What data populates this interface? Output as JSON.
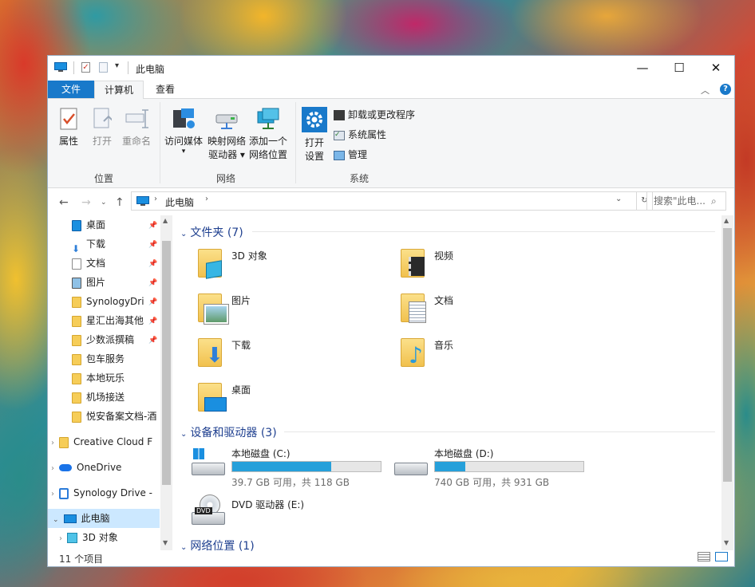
{
  "window": {
    "title": "此电脑"
  },
  "tabs": {
    "file": "文件",
    "computer": "计算机",
    "view": "查看"
  },
  "ribbon": {
    "location": {
      "label": "位置",
      "properties": "属性",
      "open": "打开",
      "rename": "重命名"
    },
    "network": {
      "label": "网络",
      "access_media": "访问媒体",
      "map_drive_1": "映射网络",
      "map_drive_2": "驱动器",
      "add_location_1": "添加一个",
      "add_location_2": "网络位置"
    },
    "system": {
      "label": "系统",
      "open_settings_1": "打开",
      "open_settings_2": "设置",
      "uninstall": "卸载或更改程序",
      "sys_props": "系统属性",
      "manage": "管理"
    }
  },
  "address": {
    "path": "此电脑",
    "search_placeholder": "搜索\"此电..."
  },
  "nav": {
    "quick": [
      {
        "label": "桌面",
        "pinned": true
      },
      {
        "label": "下载",
        "pinned": true
      },
      {
        "label": "文档",
        "pinned": true
      },
      {
        "label": "图片",
        "pinned": true
      },
      {
        "label": "SynologyDri",
        "pinned": true
      },
      {
        "label": "星汇出海其他",
        "pinned": true
      },
      {
        "label": "少数派撰稿",
        "pinned": true
      },
      {
        "label": "包车服务",
        "pinned": false
      },
      {
        "label": "本地玩乐",
        "pinned": false
      },
      {
        "label": "机场接送",
        "pinned": false
      },
      {
        "label": "悦安备案文档-酒",
        "pinned": false
      }
    ],
    "creative_cloud": "Creative Cloud F",
    "onedrive": "OneDrive",
    "synology_drive": "Synology Drive -",
    "this_pc": "此电脑",
    "objects_3d": "3D 对象"
  },
  "content": {
    "folders_header": "文件夹 (7)",
    "folders": [
      "3D 对象",
      "视频",
      "图片",
      "文档",
      "下载",
      "音乐",
      "桌面"
    ],
    "devices_header": "设备和驱动器 (3)",
    "drives": [
      {
        "name": "本地磁盘 (C:)",
        "info": "39.7 GB 可用，共 118 GB",
        "used_fraction": 0.664
      },
      {
        "name": "本地磁盘 (D:)",
        "info": "740 GB 可用，共 931 GB",
        "used_fraction": 0.205
      }
    ],
    "dvd": "DVD 驱动器 (E:)",
    "dvd_badge": "DVD",
    "network_header": "网络位置 (1)"
  },
  "status": {
    "count": "11 个项目"
  },
  "colors": {
    "accent": "#1979ca",
    "drive_bar": "#26a0da",
    "section_header": "#1e3f8f"
  }
}
